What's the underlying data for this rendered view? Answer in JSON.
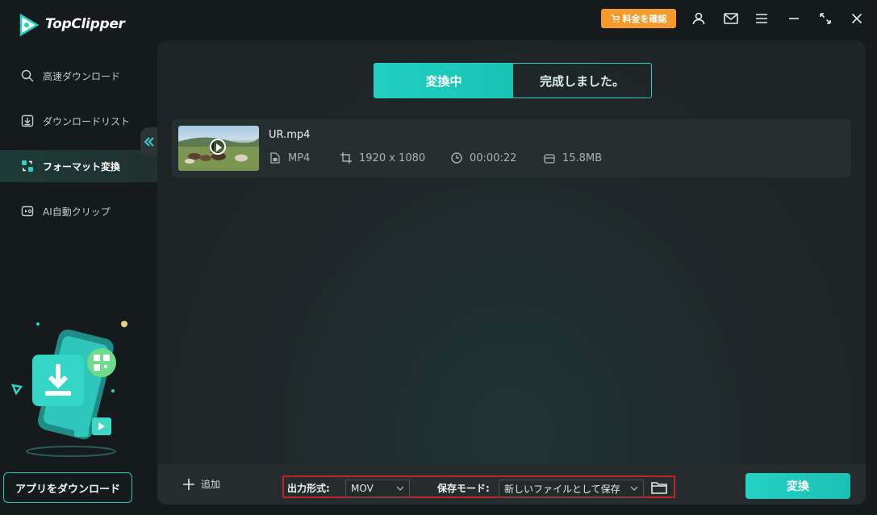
{
  "app": {
    "brand": "TopClipper"
  },
  "titlebar": {
    "price_button": "料金を確認"
  },
  "sidebar": {
    "items": [
      {
        "label": "高速ダウンロード",
        "icon": "search-icon"
      },
      {
        "label": "ダウンロードリスト",
        "icon": "download-list-icon"
      },
      {
        "label": "フォーマット変換",
        "icon": "format-convert-icon",
        "active": true
      },
      {
        "label": "AI自動クリップ",
        "icon": "ai-clip-icon"
      }
    ],
    "app_download_button": "アプリをダウンロード"
  },
  "tabs": [
    {
      "label": "変換中",
      "active": true
    },
    {
      "label": "完成しました。",
      "active": false
    }
  ],
  "file": {
    "name": "UR.mp4",
    "format": "MP4",
    "resolution": "1920 x 1080",
    "duration": "00:00:22",
    "size": "15.8MB"
  },
  "bottom": {
    "add_label": "追加",
    "output_format_label": "出力形式:",
    "output_format_value": "MOV",
    "save_mode_label": "保存モード:",
    "save_mode_value": "新しいファイルとして保存",
    "convert_button": "変換"
  },
  "colors": {
    "accent": "#20d0c2",
    "price": "#f59a2b",
    "highlight_box": "#c0242a"
  }
}
